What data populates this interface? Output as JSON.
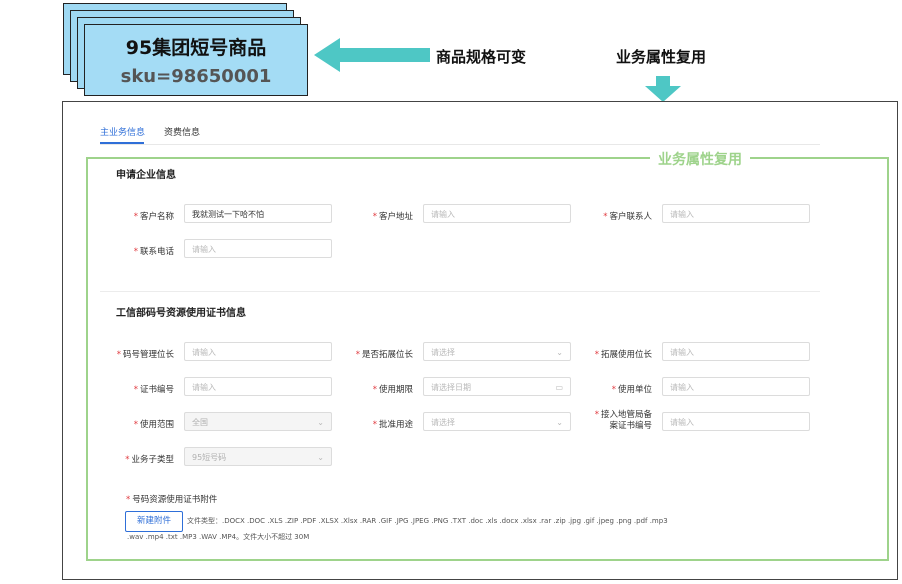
{
  "product_card": {
    "title": "95集团短号商品",
    "sku": "sku=98650001"
  },
  "annotations": {
    "spec_variable": "商品规格可变",
    "attr_reuse_top": "业务属性复用",
    "attr_reuse_frame": "业务属性复用"
  },
  "colors": {
    "accent": "#2f6fd8",
    "required": "#e0393e",
    "green_frame": "#9ed38b",
    "arrow": "#4ec7c5",
    "card": "#a4dcf5"
  },
  "tabs": [
    {
      "label": "主业务信息",
      "active": true
    },
    {
      "label": "资费信息",
      "active": false
    }
  ],
  "section1": {
    "title": "申请企业信息",
    "fields": {
      "customer_name": {
        "label": "客户名称",
        "value": "我就测试一下哈不怕"
      },
      "customer_address": {
        "label": "客户地址",
        "placeholder": "请输入"
      },
      "customer_contact": {
        "label": "客户联系人",
        "placeholder": "请输入"
      },
      "phone": {
        "label": "联系电话",
        "placeholder": "请输入"
      }
    }
  },
  "section2": {
    "title": "工信部码号资源使用证书信息",
    "fields": {
      "number_manager": {
        "label": "码号管理位长",
        "placeholder": "请输入"
      },
      "extend_length": {
        "label": "是否拓展位长",
        "placeholder": "请选择"
      },
      "extend_use_length": {
        "label": "拓展使用位长",
        "placeholder": "请输入"
      },
      "cert_no": {
        "label": "证书编号",
        "placeholder": "请输入"
      },
      "use_period": {
        "label": "使用期限",
        "placeholder": "请选择日期"
      },
      "use_unit": {
        "label": "使用单位",
        "placeholder": "请输入"
      },
      "use_scope": {
        "label": "使用范围",
        "value": "全国"
      },
      "approved_use": {
        "label": "批准用途",
        "placeholder": "请选择"
      },
      "local_record_no": {
        "label_line1": "接入地管局备",
        "label_line2": "案证书编号",
        "placeholder": "请输入"
      },
      "biz_subtype": {
        "label": "业务子类型",
        "value": "95短号码"
      }
    }
  },
  "attachment": {
    "label": "号码资源使用证书附件",
    "button": "新建附件",
    "types_line1": "文件类型：.DOCX .DOC .XLS .ZIP .PDF .XLSX .Xlsx .RAR .GIF .JPG .JPEG .PNG .TXT .doc .xls .docx .xlsx .rar .zip .jpg .gif .jpeg .png .pdf .mp3",
    "types_line2": ".wav .mp4 .txt .MP3 .WAV .MP4。文件大小不超过 30M"
  },
  "icons": {
    "select_arrow": "chevron-down-icon",
    "date": "calendar-icon"
  }
}
